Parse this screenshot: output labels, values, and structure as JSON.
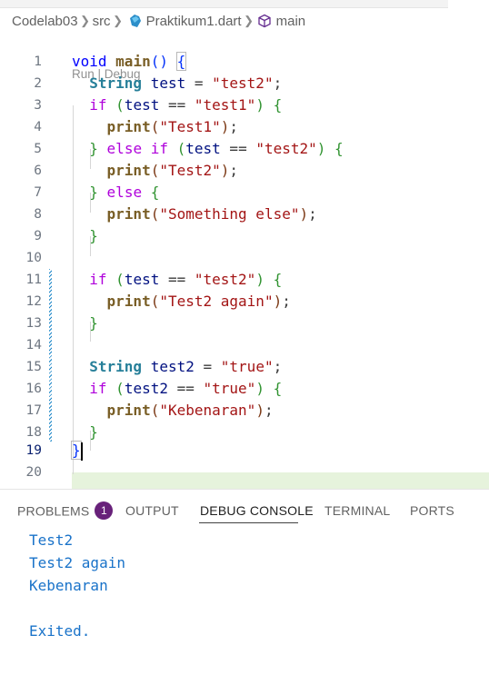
{
  "breadcrumb": {
    "folder": "Codelab03",
    "subfolder": "src",
    "file": "Praktikum1.dart",
    "symbol": "main",
    "separator": ">"
  },
  "codelens": "Run | Debug",
  "line_numbers": [
    "1",
    "2",
    "3",
    "4",
    "5",
    "6",
    "7",
    "8",
    "9",
    "10",
    "11",
    "12",
    "13",
    "14",
    "15",
    "16",
    "17",
    "18",
    "19",
    "20"
  ],
  "code": {
    "void": "void",
    "main": "main",
    "String": "String",
    "if": "if",
    "else": "else",
    "print": "print",
    "test": "test",
    "test2_var": "test2",
    "str_test2": "\"test2\"",
    "str_test1": "\"test1\"",
    "str_Test1": "\"Test1\"",
    "str_Test2": "\"Test2\"",
    "str_something": "\"Something else\"",
    "str_again": "\"Test2 again\"",
    "str_true": "\"true\"",
    "str_kebenaran": "\"Kebenaran\""
  },
  "panel": {
    "tabs": {
      "problems": "PROBLEMS",
      "problems_count": "1",
      "output": "OUTPUT",
      "debug_console": "DEBUG CONSOLE",
      "terminal": "TERMINAL",
      "ports": "PORTS"
    },
    "active_tab": "DEBUG CONSOLE",
    "console_output": [
      "Test2",
      "Test2 again",
      "Kebenaran",
      "",
      "Exited."
    ]
  },
  "colors": {
    "keyword": "#0000ff",
    "control": "#af00db",
    "type": "#267f99",
    "function": "#795e26",
    "variable": "#001080",
    "string": "#a31515",
    "console_text": "#1a73c9",
    "badge": "#68217a",
    "current_line": "#e6f3dc"
  },
  "icons": [
    "dart-file-icon",
    "symbol-method-icon"
  ]
}
